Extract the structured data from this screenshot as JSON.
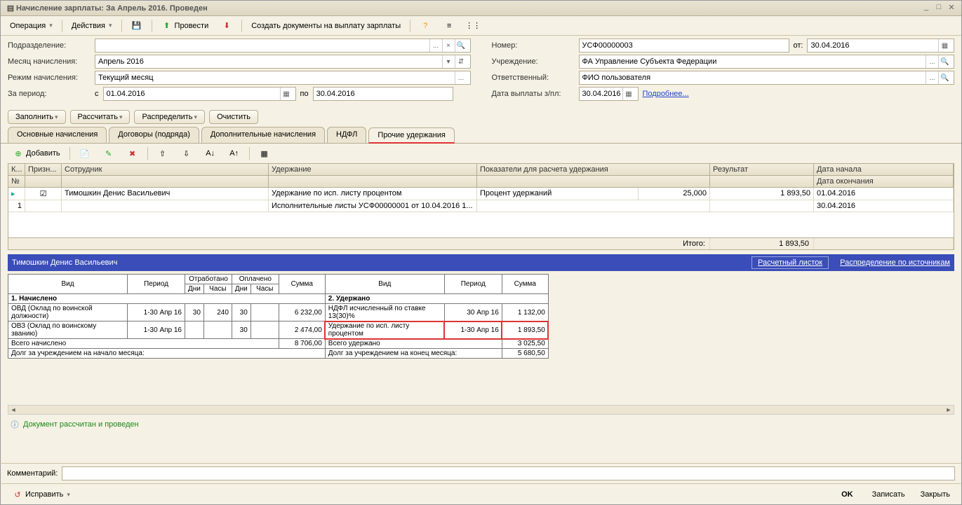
{
  "window": {
    "title": "Начисление зарплаты: За Апрель 2016. Проведен"
  },
  "toolbar": {
    "operation": "Операция",
    "actions": "Действия",
    "post": "Провести",
    "createPayDocs": "Создать документы на выплату зарплаты"
  },
  "form": {
    "podrazdelenie_lbl": "Подразделение:",
    "monthAccr_lbl": "Месяц начисления:",
    "monthAccr_val": "Апрель 2016",
    "modeAccr_lbl": "Режим начисления:",
    "modeAccr_val": "Текущий месяц",
    "period_lbl": "За период:",
    "period_from_lbl": "с",
    "period_from": "01.04.2016",
    "period_to_lbl": "по",
    "period_to": "30.04.2016",
    "number_lbl": "Номер:",
    "number_val": "УСФ00000003",
    "date_lbl": "от:",
    "date_val": "30.04.2016",
    "org_lbl": "Учреждение:",
    "org_val": "ФА Управление Субъекта Федерации",
    "resp_lbl": "Ответственный:",
    "resp_val": "ФИО пользователя",
    "payDate_lbl": "Дата выплаты з/пл:",
    "payDate_val": "30.04.2016",
    "more": "Подробнее..."
  },
  "buttons": {
    "fill": "Заполнить",
    "calc": "Рассчитать",
    "distr": "Распределить",
    "clear": "Очистить"
  },
  "tabs": {
    "main": "Основные начисления",
    "contracts": "Договоры (подряда)",
    "add": "Дополнительные начисления",
    "ndfl": "НДФЛ",
    "other": "Прочие удержания"
  },
  "subtb": {
    "add": "Добавить"
  },
  "gridH": {
    "k": "К...",
    "prizn": "Призн...",
    "no": "№",
    "emp": "Сотрудник",
    "ded": "Удержание",
    "ind": "Показатели для расчета удержания",
    "res": "Результат",
    "dstart": "Дата начала",
    "dend": "Дата окончания"
  },
  "gridR": {
    "no": "1",
    "emp": "Тимошкин Денис Васильевич",
    "ded1": "Удержание по исп. листу процентом",
    "ded2": "Исполнительные листы УСФ00000001 от 10.04.2016 1...",
    "ind_lbl": "Процент удержаний",
    "ind_val": "25,000",
    "res": "1 893,50",
    "dstart": "01.04.2016",
    "dend": "30.04.2016"
  },
  "gridF": {
    "total_lbl": "Итого:",
    "total_val": "1 893,50"
  },
  "detail": {
    "name": "Тимошкин Денис Васильевич",
    "paysheet": "Расчетный листок",
    "bySource": "Распределение по источникам"
  },
  "pt": {
    "h_vid": "Вид",
    "h_period": "Период",
    "h_otrab": "Отработано",
    "h_opl": "Оплачено",
    "h_dni": "Дни",
    "h_chasy": "Часы",
    "h_summa": "Сумма",
    "s1": "1. Начислено",
    "s2": "2. Удержано",
    "r1_vid": "ОВД (Оклад по воинской должности)",
    "r1_per": "1-30 Апр 16",
    "r1_dni": "30",
    "r1_ch": "240",
    "r1_dni2": "30",
    "r1_sum": "6 232,00",
    "r2_vid": "ОВЗ (Оклад по воинскому званию)",
    "r2_per": "1-30 Апр 16",
    "r2_dni2": "30",
    "r2_sum": "2 474,00",
    "r3_vid": "Всего начислено",
    "r3_sum": "8 706,00",
    "r4_vid": "Долг за учреждением на начало месяца:",
    "d1_vid": "НДФЛ исчисленный по ставке 13(30)%",
    "d1_per": "30 Апр 16",
    "d1_sum": "1 132,00",
    "d2_vid": "Удержание по исп. листу процентом",
    "d2_per": "1-30 Апр 16",
    "d2_sum": "1 893,50",
    "d3_vid": "Всего удержано",
    "d3_sum": "3 025,50",
    "d4_vid": "Долг за учреждением на конец месяца:",
    "d4_sum": "5 680,50"
  },
  "status": {
    "msg": "Документ рассчитан и проведен"
  },
  "comment": {
    "lbl": "Комментарий:"
  },
  "fix": {
    "lbl": "Исправить"
  },
  "foot": {
    "ok": "OK",
    "write": "Записать",
    "close": "Закрыть"
  }
}
